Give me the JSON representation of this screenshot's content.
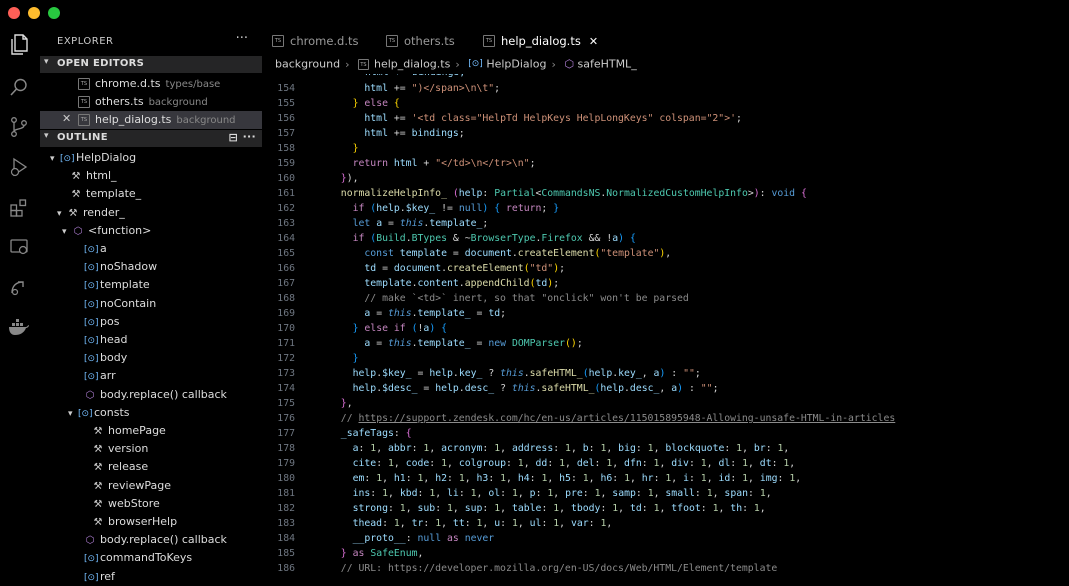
{
  "window": {
    "traffic_lights": {
      "close": "#fe5f57",
      "minimize": "#febc2e",
      "maximize": "#28c840"
    }
  },
  "activity_bar": [
    "files-icon",
    "search-icon",
    "source-control-icon",
    "run-debug-icon",
    "extensions-icon",
    "remote-explorer-icon",
    "remote-icon",
    "docker-icon"
  ],
  "explorer": {
    "title": "EXPLORER",
    "more": "···",
    "open_editors_label": "OPEN EDITORS",
    "open_editors": [
      {
        "name": "chrome.d.ts",
        "desc": "types/base"
      },
      {
        "name": "others.ts",
        "desc": "background"
      },
      {
        "name": "help_dialog.ts",
        "desc": "background",
        "close": "✕"
      }
    ],
    "outline_label": "OUTLINE",
    "outline": [
      {
        "label": "HelpDialog"
      },
      {
        "label": "html_"
      },
      {
        "label": "template_"
      },
      {
        "label": "render_"
      },
      {
        "label": "<function>"
      },
      {
        "label": "a"
      },
      {
        "label": "noShadow"
      },
      {
        "label": "template"
      },
      {
        "label": "noContain"
      },
      {
        "label": "pos"
      },
      {
        "label": "head"
      },
      {
        "label": "body"
      },
      {
        "label": "arr"
      },
      {
        "label": "body.replace() callback"
      },
      {
        "label": "consts"
      },
      {
        "label": "homePage"
      },
      {
        "label": "version"
      },
      {
        "label": "release"
      },
      {
        "label": "reviewPage"
      },
      {
        "label": "webStore"
      },
      {
        "label": "browserHelp"
      },
      {
        "label": "body.replace() callback"
      },
      {
        "label": "commandToKeys"
      },
      {
        "label": "ref"
      }
    ]
  },
  "tabs": [
    {
      "label": "chrome.d.ts"
    },
    {
      "label": "others.ts"
    },
    {
      "label": "help_dialog.ts",
      "close": "✕"
    }
  ],
  "breadcrumb": [
    "background",
    "help_dialog.ts",
    "HelpDialog",
    "safeHTML_"
  ],
  "code": {
    "line_numbers": [
      "154",
      "155",
      "156",
      "157",
      "158",
      "159",
      "160",
      "161",
      "162",
      "163",
      "164",
      "165",
      "166",
      "167",
      "168",
      "169",
      "170",
      "171",
      "172",
      "173",
      "174",
      "175",
      "176",
      "177",
      "178",
      "179",
      "180",
      "181",
      "182",
      "183",
      "184",
      "185",
      "186"
    ],
    "partial_top_line": "html += bindings;",
    "partial_bottom_line": "  // URL: https://developer.mozilla.org/en-US/docs/Web/HTML/Element/template",
    "strings": {
      "s154": "\")</span>\\n\\t\"",
      "s157": "'<td class=\"HelpTd HelpKeys HelpLongKeys\" colspan=\"2\">'",
      "s160": "\"</td>\\n</tr>\\n\"",
      "s166": "\"template\"",
      "s167": "\"td\"",
      "c169": "// make `<td>` inert, so that \"onclick\" won't be parsed",
      "s174": "\"\"",
      "s175": "\"\"",
      "url177": "https://support.zendesk.com/hc/en-us/articles/115015895948-Allowing-unsafe-HTML-in-articles"
    },
    "types": {
      "t162a": "Partial",
      "t162b": "CommandsNS",
      "t162c": "NormalizedCustomHelpInfo",
      "t165a": "Build",
      "t165b": "BTypes",
      "t165c": "BrowserType",
      "t165d": "Firefox",
      "t172": "DOMParser",
      "t186": "SafeEnum"
    },
    "safe_tags": {
      "l179": [
        "a",
        "abbr",
        "acronym",
        "address",
        "b",
        "big",
        "blockquote",
        "br"
      ],
      "l180": [
        "cite",
        "code",
        "colgroup",
        "dd",
        "del",
        "dfn",
        "div",
        "dl",
        "dt"
      ],
      "l181": [
        "em",
        "h1",
        "h2",
        "h3",
        "h4",
        "h5",
        "h6",
        "hr",
        "i",
        "id",
        "img"
      ],
      "l182": [
        "ins",
        "kbd",
        "li",
        "ol",
        "p",
        "pre",
        "samp",
        "small",
        "span"
      ],
      "l183": [
        "strong",
        "sub",
        "sup",
        "table",
        "tbody",
        "td",
        "tfoot",
        "th"
      ],
      "l184": [
        "thead",
        "tr",
        "tt",
        "u",
        "ul",
        "var"
      ]
    }
  }
}
